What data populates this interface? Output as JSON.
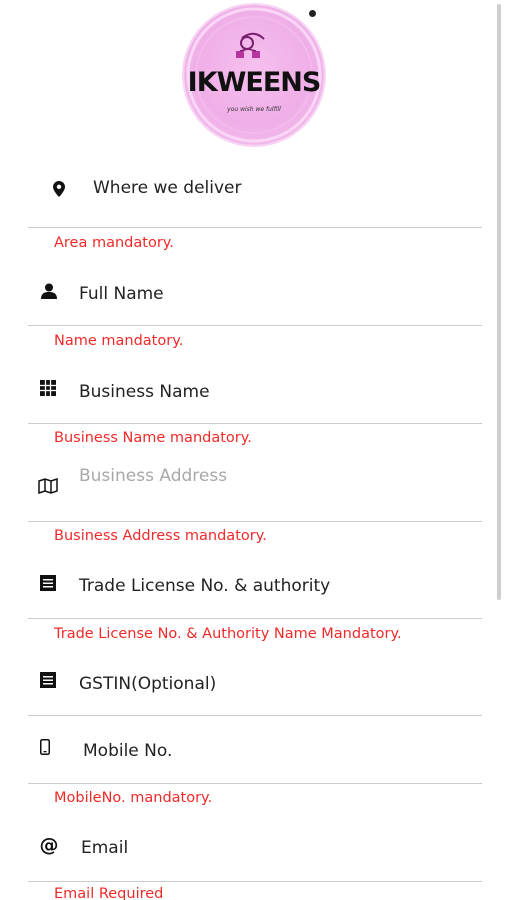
{
  "logo": {
    "brand_text": "IKWEENS",
    "tagline": "you wish we fulfill"
  },
  "form": {
    "fields": [
      {
        "icon": "map-marker-icon",
        "value": "Where we deliver",
        "error": "Area mandatory."
      },
      {
        "icon": "user-icon",
        "value": "Full Name",
        "error": "Name mandatory."
      },
      {
        "icon": "grid-icon",
        "value": "Business Name",
        "error": "Business Name mandatory."
      },
      {
        "icon": "map-icon",
        "placeholder": "Business Address",
        "error": "Business Address mandatory."
      },
      {
        "icon": "list-icon",
        "value": "Trade License No. & authority",
        "error": "Trade License No. & Authority Name Mandatory."
      },
      {
        "icon": "list-icon",
        "value": "GSTIN(Optional)"
      },
      {
        "icon": "mobile-icon",
        "value": "Mobile No.",
        "error": "MobileNo. mandatory."
      },
      {
        "icon": "at-icon",
        "value": "Email",
        "error": "Email Required"
      }
    ]
  },
  "colors": {
    "error": "#f02a2a",
    "logo_background": "#efaee7",
    "divider": "#cccccc"
  }
}
